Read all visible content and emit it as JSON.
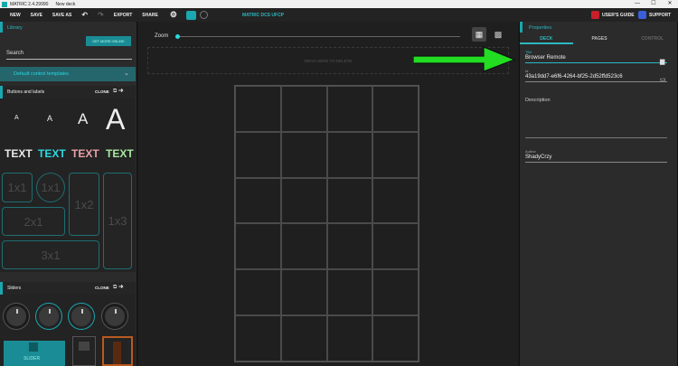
{
  "titlebar": {
    "app": "MATRIC 2.4.29990",
    "doc": "New deck",
    "minimize": "—",
    "maximize": "☐",
    "close": "✕"
  },
  "menu": {
    "new": "NEW",
    "save": "SAVE",
    "save_as": "SAVE AS",
    "undo": "↶",
    "redo": "↷",
    "export": "EXPORT",
    "share": "SHARE",
    "title": "MATRIC DCS UFCP",
    "users_guide": "USER'S GUIDE",
    "support": "SUPPORT",
    "gear": "⚙"
  },
  "library": {
    "header": "Library",
    "get_more": "GET MORE ONLINE",
    "search": "Search",
    "templates": "Default control templates",
    "templates_chevron": "⌄",
    "sections": [
      {
        "label": "Buttons and labels",
        "clone": "CLONE",
        "clone_icon": "⧉ ➜"
      },
      {
        "label": "Sliders",
        "clone": "CLONE",
        "clone_icon": "⧉ ➜"
      }
    ],
    "sizes": [
      "A",
      "A",
      "A",
      "A"
    ],
    "text_labels": [
      "TEXT",
      "TEXT",
      "TEXT",
      "TEXT"
    ],
    "text_colors": [
      "#e8e8e8",
      "#2bd8e2",
      "#e8a0a8",
      "#a8e8a0"
    ],
    "tiles": [
      "1x1",
      "1x1",
      "1x2",
      "1x3",
      "2x1",
      "3x1"
    ],
    "slider_label": "SLIDER"
  },
  "center": {
    "zoom_label": "Zoom",
    "zoom_value": 0,
    "grid_icon": "▦",
    "qr_icon": "▩",
    "drop_hint": "DRAG HERE TO DELETE",
    "grid_cols": 4,
    "grid_rows": 6
  },
  "props": {
    "header": "Properties",
    "tabs": [
      "DECK",
      "PAGES",
      "CONTROL"
    ],
    "title_label": "Title",
    "title_value": "Browser Remote",
    "id_label": "Id",
    "id_value": "43a19dd7-e6f6-4264-bf25-2d52ffd523c6",
    "description_label": "Description",
    "author_label": "Author",
    "author_value": "ShadyCrzy",
    "folder_icon": "▆",
    "clipboard_icon": "▭"
  },
  "colors": {
    "accent": "#1aa7b0",
    "annotation_arrow": "#22dd22"
  }
}
